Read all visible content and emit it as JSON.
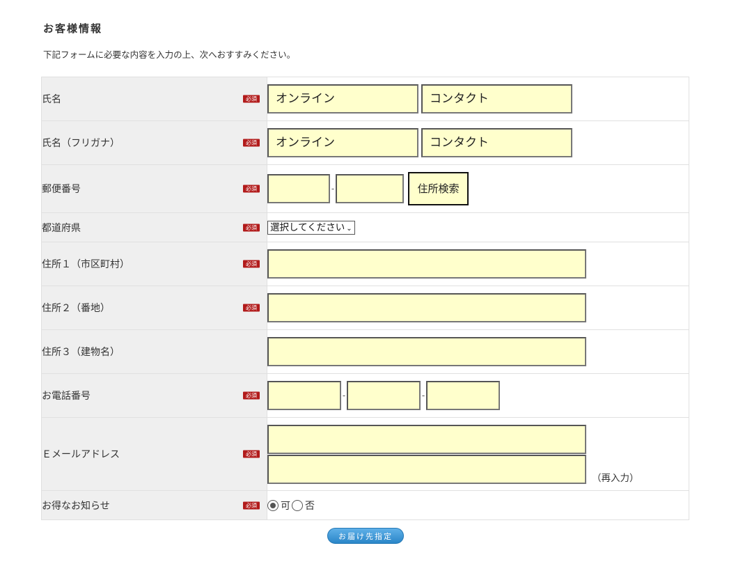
{
  "section_title": "お客様情報",
  "intro": "下記フォームに必要な内容を入力の上、次へおすすみください。",
  "required_badge": "必須",
  "rows": {
    "name": {
      "label": "氏名",
      "last": "オンライン",
      "first": "コンタクト"
    },
    "kana": {
      "label": "氏名（フリガナ）",
      "last": "オンライン",
      "first": "コンタクト"
    },
    "zip": {
      "label": "郵便番号",
      "part1": "",
      "part2": "",
      "separator": "-",
      "search_button": "住所検索"
    },
    "pref": {
      "label": "都道府県",
      "selected": "選択してください"
    },
    "addr1": {
      "label": "住所１（市区町村）",
      "value": ""
    },
    "addr2": {
      "label": "住所２（番地）",
      "value": ""
    },
    "addr3": {
      "label": "住所３（建物名）",
      "value": ""
    },
    "tel": {
      "label": "お電話番号",
      "part1": "",
      "part2": "",
      "part3": "",
      "separator": "-"
    },
    "email": {
      "label": "Ｅメールアドレス",
      "value": "",
      "confirm": "",
      "confirm_note": "（再入力）"
    },
    "news": {
      "label": "お得なお知らせ",
      "option_yes": "可",
      "option_no": "否",
      "selected": "可"
    }
  },
  "submit_label": "お届け先指定",
  "colors": {
    "input_bg": "#ffffcc",
    "label_bg": "#efefef",
    "required": "#b21b1b",
    "button": "#3a95d6"
  }
}
